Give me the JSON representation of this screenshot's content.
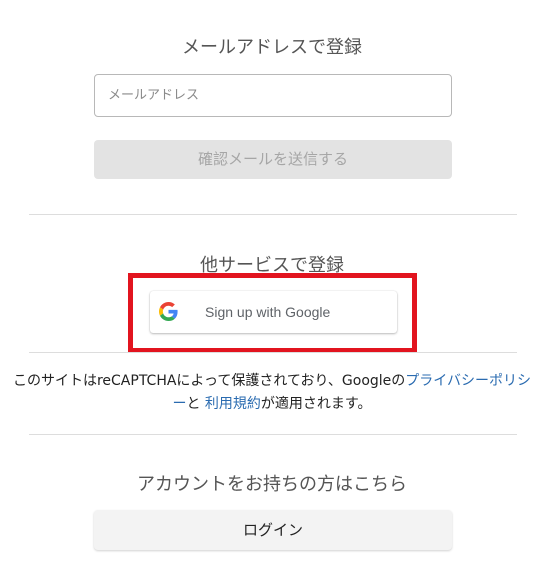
{
  "email_section": {
    "heading": "メールアドレスで登録",
    "email_placeholder": "メールアドレス",
    "send_button_label": "確認メールを送信する"
  },
  "social_section": {
    "heading": "他サービスで登録",
    "google_button_label": "Sign up with Google",
    "google_icon": "google-g-logo"
  },
  "notice": {
    "text_before": "このサイトはreCAPTCHAによって保護されており、Googleの",
    "privacy_link": "プライバシーポリシー",
    "text_middle": "と",
    "terms_link": "利用規約",
    "text_after": "が適用されます。"
  },
  "login_section": {
    "heading": "アカウントをお持ちの方はこちら",
    "login_button_label": "ログイン"
  },
  "colors": {
    "highlight_border": "#e2141f",
    "link": "#2a6bb0",
    "google_blue": "#4285F4",
    "google_red": "#EA4335",
    "google_yellow": "#FBBC05",
    "google_green": "#34A853"
  }
}
